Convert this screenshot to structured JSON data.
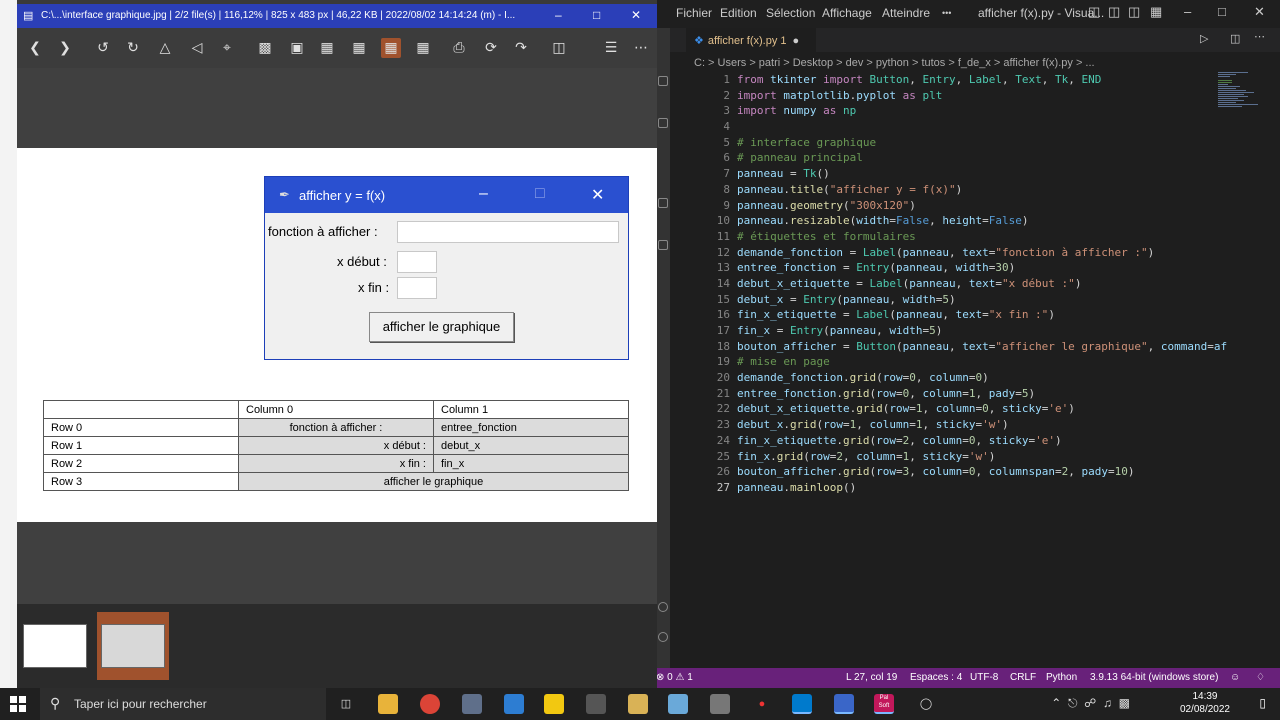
{
  "vscode": {
    "menus": [
      "Fichier",
      "Edition",
      "Sélection",
      "Affichage",
      "Atteindre"
    ],
    "overflow": "•••",
    "window_title": "afficher f(x).py - Visua...",
    "tab_label": "afficher f(x).py 1",
    "breadcrumb": "C: > Users > patri > Desktop > dev > python > tutos > f_de_x > afficher f(x).py > ...",
    "code_lines": [
      "from tkinter import Button, Entry, Label, Text, Tk, END",
      "import matplotlib.pyplot as plt",
      "import numpy as np",
      "",
      "# interface graphique",
      "# panneau principal",
      "panneau = Tk()",
      "panneau.title(\"afficher y = f(x)\")",
      "panneau.geometry(\"300x120\")",
      "panneau.resizable(width=False, height=False)",
      "# étiquettes et formulaires",
      "demande_fonction = Label(panneau, text=\"fonction à afficher :\")",
      "entree_fonction = Entry(panneau, width=30)",
      "debut_x_etiquette = Label(panneau, text=\"x début :\")",
      "debut_x = Entry(panneau, width=5)",
      "fin_x_etiquette = Label(panneau, text=\"x fin :\")",
      "fin_x = Entry(panneau, width=5)",
      "bouton_afficher = Button(panneau, text=\"afficher le graphique\", command=af",
      "# mise en page",
      "demande_fonction.grid(row=0, column=0)",
      "entree_fonction.grid(row=0, column=1, pady=5)",
      "debut_x_etiquette.grid(row=1, column=0, sticky='e')",
      "debut_x.grid(row=1, column=1, sticky='w')",
      "fin_x_etiquette.grid(row=2, column=0, sticky='e')",
      "fin_x.grid(row=2, column=1, sticky='w')",
      "bouton_afficher.grid(row=3, column=0, columnspan=2, pady=10)",
      "panneau.mainloop()"
    ],
    "status": {
      "problems": "⊗ 0 ⚠ 1",
      "position": "L 27, col 19",
      "spaces": "Espaces : 4",
      "encoding": "UTF-8",
      "eol": "CRLF",
      "language": "Python",
      "interpreter": "3.9.13 64-bit (windows store)"
    }
  },
  "viewer": {
    "title": "C:\\...\\interface graphique.jpg  |  2/2 file(s)  |  116,12%  |  825 x 483 px  |  46,22 KB  |  2022/08/02 14:14:24 (m)  -  I...",
    "tk_window": {
      "title": "afficher y = f(x)",
      "label_fonction": "fonction à afficher :",
      "label_debut": "x début :",
      "label_fin": "x fin :",
      "button": "afficher le graphique"
    },
    "grid_table": {
      "header": [
        "",
        "Column 0",
        "Column 1"
      ],
      "rows": [
        [
          "Row 0",
          "fonction à afficher :",
          "entree_fonction"
        ],
        [
          "Row 1",
          "x début :",
          "debut_x"
        ],
        [
          "Row 2",
          "x fin :",
          "fin_x"
        ],
        [
          "Row 3",
          "afficher le graphique",
          ""
        ]
      ]
    }
  },
  "taskbar": {
    "search_placeholder": "Taper ici pour rechercher",
    "time": "14:39",
    "date": "02/08/2022",
    "pal_label": "Pal Soft"
  }
}
